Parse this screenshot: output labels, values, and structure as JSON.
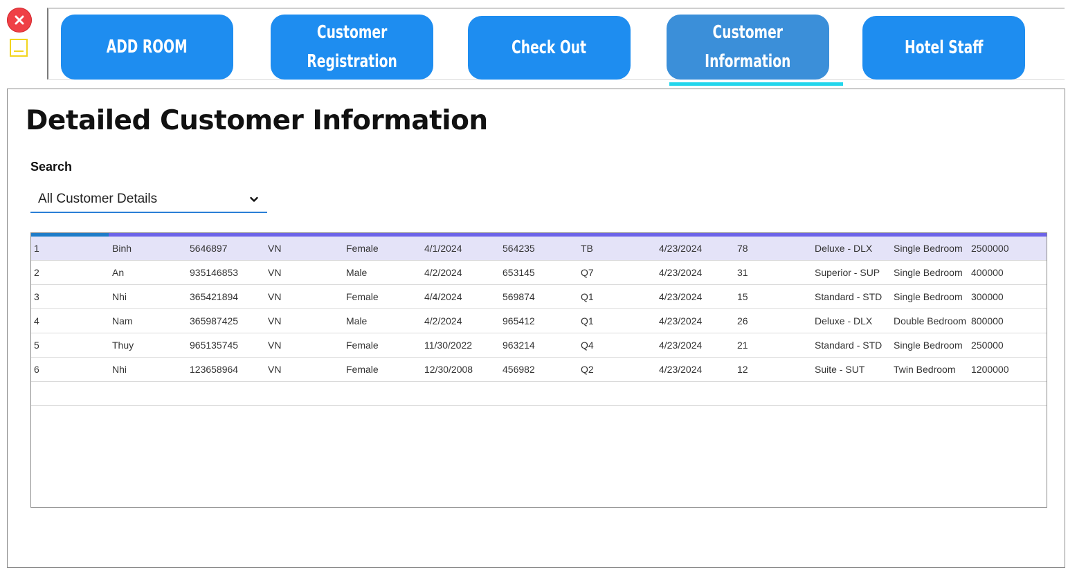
{
  "window": {
    "close_icon": "close-icon",
    "minimize_icon": "minimize-icon"
  },
  "nav": {
    "buttons": [
      {
        "label": "ADD ROOM"
      },
      {
        "label": "Customer\nRegistration"
      },
      {
        "label": "Check Out"
      },
      {
        "label": "Customer\nInformation"
      },
      {
        "label": "Hotel Staff"
      }
    ],
    "active_index": 3,
    "colors": {
      "button": "#1e8df0",
      "active": "#3b8fd9",
      "indicator": "#23d6ec"
    }
  },
  "page": {
    "title": "Detailed Customer Information"
  },
  "search": {
    "label": "Search",
    "selected": "All Customer Details"
  },
  "table": {
    "selected_row": 0,
    "rows": [
      [
        "1",
        "Binh",
        "5646897",
        "VN",
        "Female",
        "4/1/2024",
        "564235",
        "TB",
        "4/23/2024",
        "78",
        "Deluxe - DLX",
        "Single Bedroom",
        "2500000"
      ],
      [
        "2",
        "An",
        "935146853",
        "VN",
        "Male",
        "4/2/2024",
        "653145",
        "Q7",
        "4/23/2024",
        "31",
        "Superior - SUP",
        "Single Bedroom",
        "400000"
      ],
      [
        "3",
        "Nhi",
        "365421894",
        "VN",
        "Female",
        "4/4/2024",
        "569874",
        "Q1",
        "4/23/2024",
        "15",
        "Standard - STD",
        "Single Bedroom",
        "300000"
      ],
      [
        "4",
        "Nam",
        "365987425",
        "VN",
        "Male",
        "4/2/2024",
        "965412",
        "Q1",
        "4/23/2024",
        "26",
        "Deluxe - DLX",
        "Double Bedroom",
        "800000"
      ],
      [
        "5",
        "Thuy",
        "965135745",
        "VN",
        "Female",
        "11/30/2022",
        "963214",
        "Q4",
        "4/23/2024",
        "21",
        "Standard - STD",
        "Single Bedroom",
        "250000"
      ],
      [
        "6",
        "Nhi",
        "123658964",
        "VN",
        "Female",
        "12/30/2008",
        "456982",
        "Q2",
        "4/23/2024",
        "12",
        "Suite - SUT",
        "Twin Bedroom",
        "1200000"
      ]
    ]
  }
}
